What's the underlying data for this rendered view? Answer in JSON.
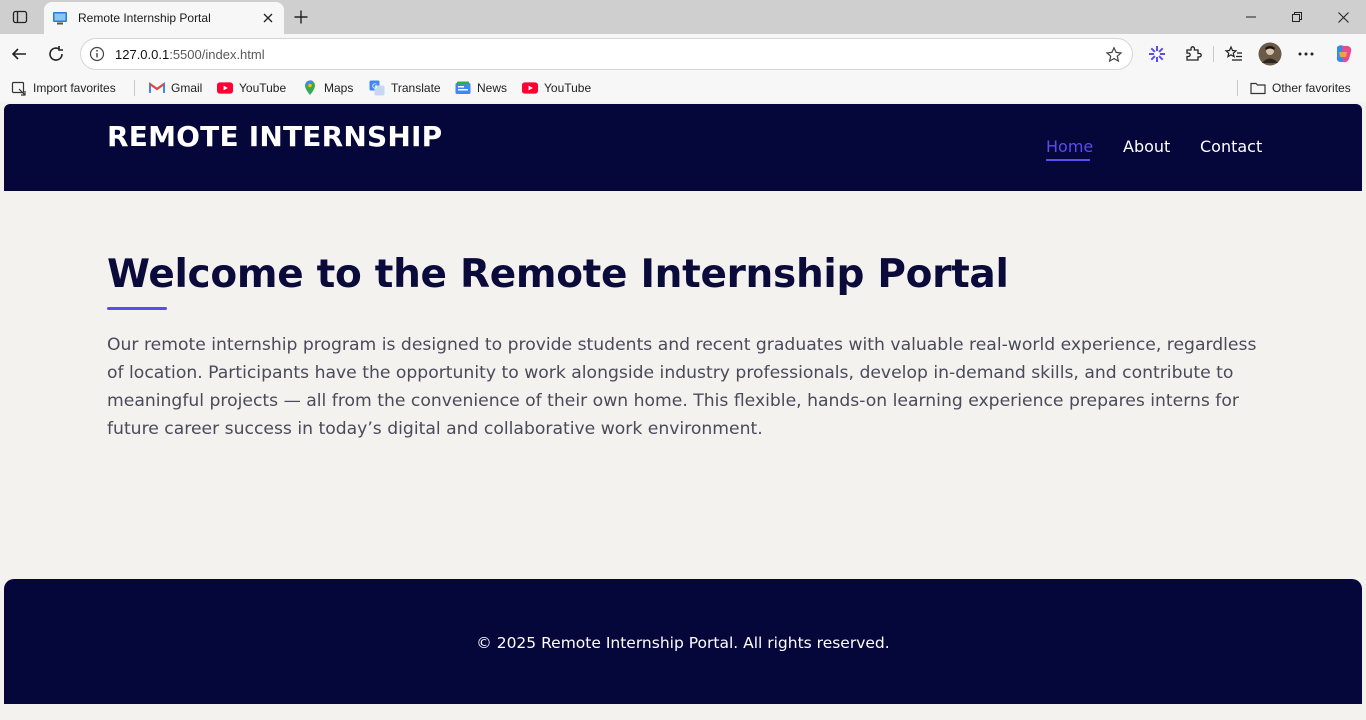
{
  "browser": {
    "tab": {
      "title": "Remote Internship Portal"
    },
    "address": {
      "host": "127.0.0.1",
      "path": ":5500/index.html"
    },
    "bookmarks": [
      {
        "label": "Import favorites",
        "icon": "import-icon"
      },
      {
        "label": "Gmail",
        "icon": "gmail-icon"
      },
      {
        "label": "YouTube",
        "icon": "youtube-icon"
      },
      {
        "label": "Maps",
        "icon": "maps-icon"
      },
      {
        "label": "Translate",
        "icon": "translate-icon"
      },
      {
        "label": "News",
        "icon": "news-icon"
      },
      {
        "label": "YouTube",
        "icon": "youtube-icon"
      }
    ],
    "other_favorites": "Other favorites"
  },
  "site": {
    "logo": "REMOTE INTERNSHIP",
    "nav": [
      {
        "label": "Home",
        "active": true
      },
      {
        "label": "About",
        "active": false
      },
      {
        "label": "Contact",
        "active": false
      }
    ],
    "title": "Welcome to the Remote Internship Portal",
    "intro": "Our remote internship program is designed to provide students and recent graduates with valuable real-world experience, regardless of location. Participants have the opportunity to work alongside industry professionals, develop in-demand skills, and contribute to meaningful projects — all from the convenience of their own home. This flexible, hands-on learning experience prepares interns for future career success in today’s digital and collaborative work environment.",
    "footer": "© 2025 Remote Internship Portal. All rights reserved."
  },
  "colors": {
    "header_bg": "#05063a",
    "accent": "#5b4cf0",
    "page_bg": "#f3f2ef",
    "heading": "#0b0b3b",
    "body_text": "#4a4a5a"
  }
}
